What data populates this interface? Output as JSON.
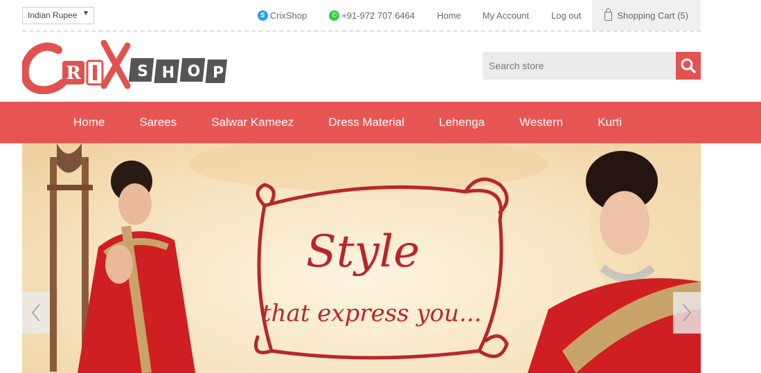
{
  "topbar": {
    "currency": "Indian Rupee",
    "skype": "CrixShop",
    "phone": "+91-972 707 6464",
    "home": "Home",
    "account": "My Account",
    "logout": "Log out",
    "cart": "Shopping Cart (5)"
  },
  "logo": {
    "text": "CrixShop"
  },
  "search": {
    "placeholder": "Search store"
  },
  "nav": {
    "items": [
      "Home",
      "Sarees",
      "Salwar Kameez",
      "Dress Material",
      "Lehenga",
      "Western",
      "Kurti"
    ]
  },
  "banner": {
    "headline": "Style",
    "tagline": "that express you..."
  },
  "colors": {
    "accent": "#e85654",
    "banner_text": "#b8262b"
  }
}
